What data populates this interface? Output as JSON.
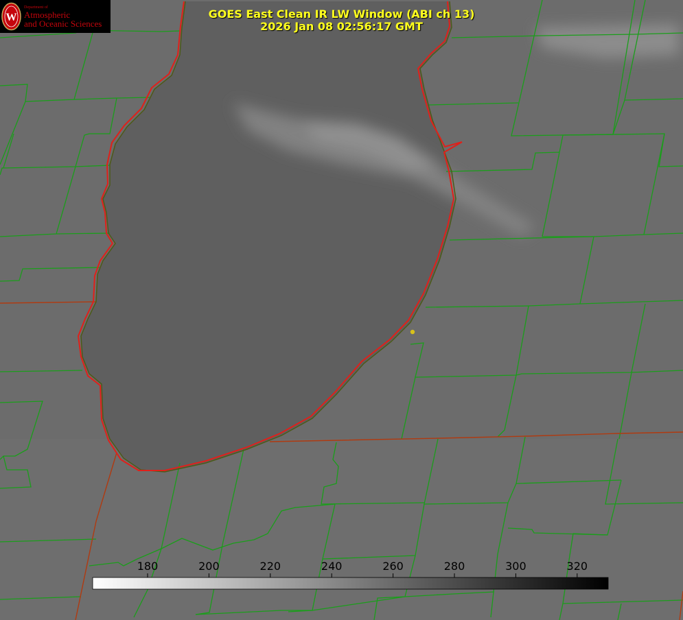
{
  "title": {
    "line1": "GOES East Clean IR LW Window (ABI ch 13)",
    "line2": "2026 Jan 08 02:56:17 GMT"
  },
  "logo": {
    "department": "Department of",
    "line1": "Atmospheric",
    "line2": "and Oceanic Sciences",
    "seal_letter": "W",
    "colors": {
      "background": "#000000",
      "text": "#c5050c",
      "seal": "#c5050c"
    }
  },
  "map": {
    "colors": {
      "ir_background": "#6c6c6c",
      "lake_fill": "#5e5e5e",
      "county_lines": "#1a9e1a",
      "state_lines": "#b03a10",
      "coastline": "#e0201a",
      "station_marker": "#d8c21a"
    }
  },
  "colorbar": {
    "ticks": [
      "180",
      "200",
      "220",
      "240",
      "260",
      "280",
      "300",
      "320"
    ],
    "colors": {
      "start": "#ffffff",
      "end": "#000000"
    }
  }
}
